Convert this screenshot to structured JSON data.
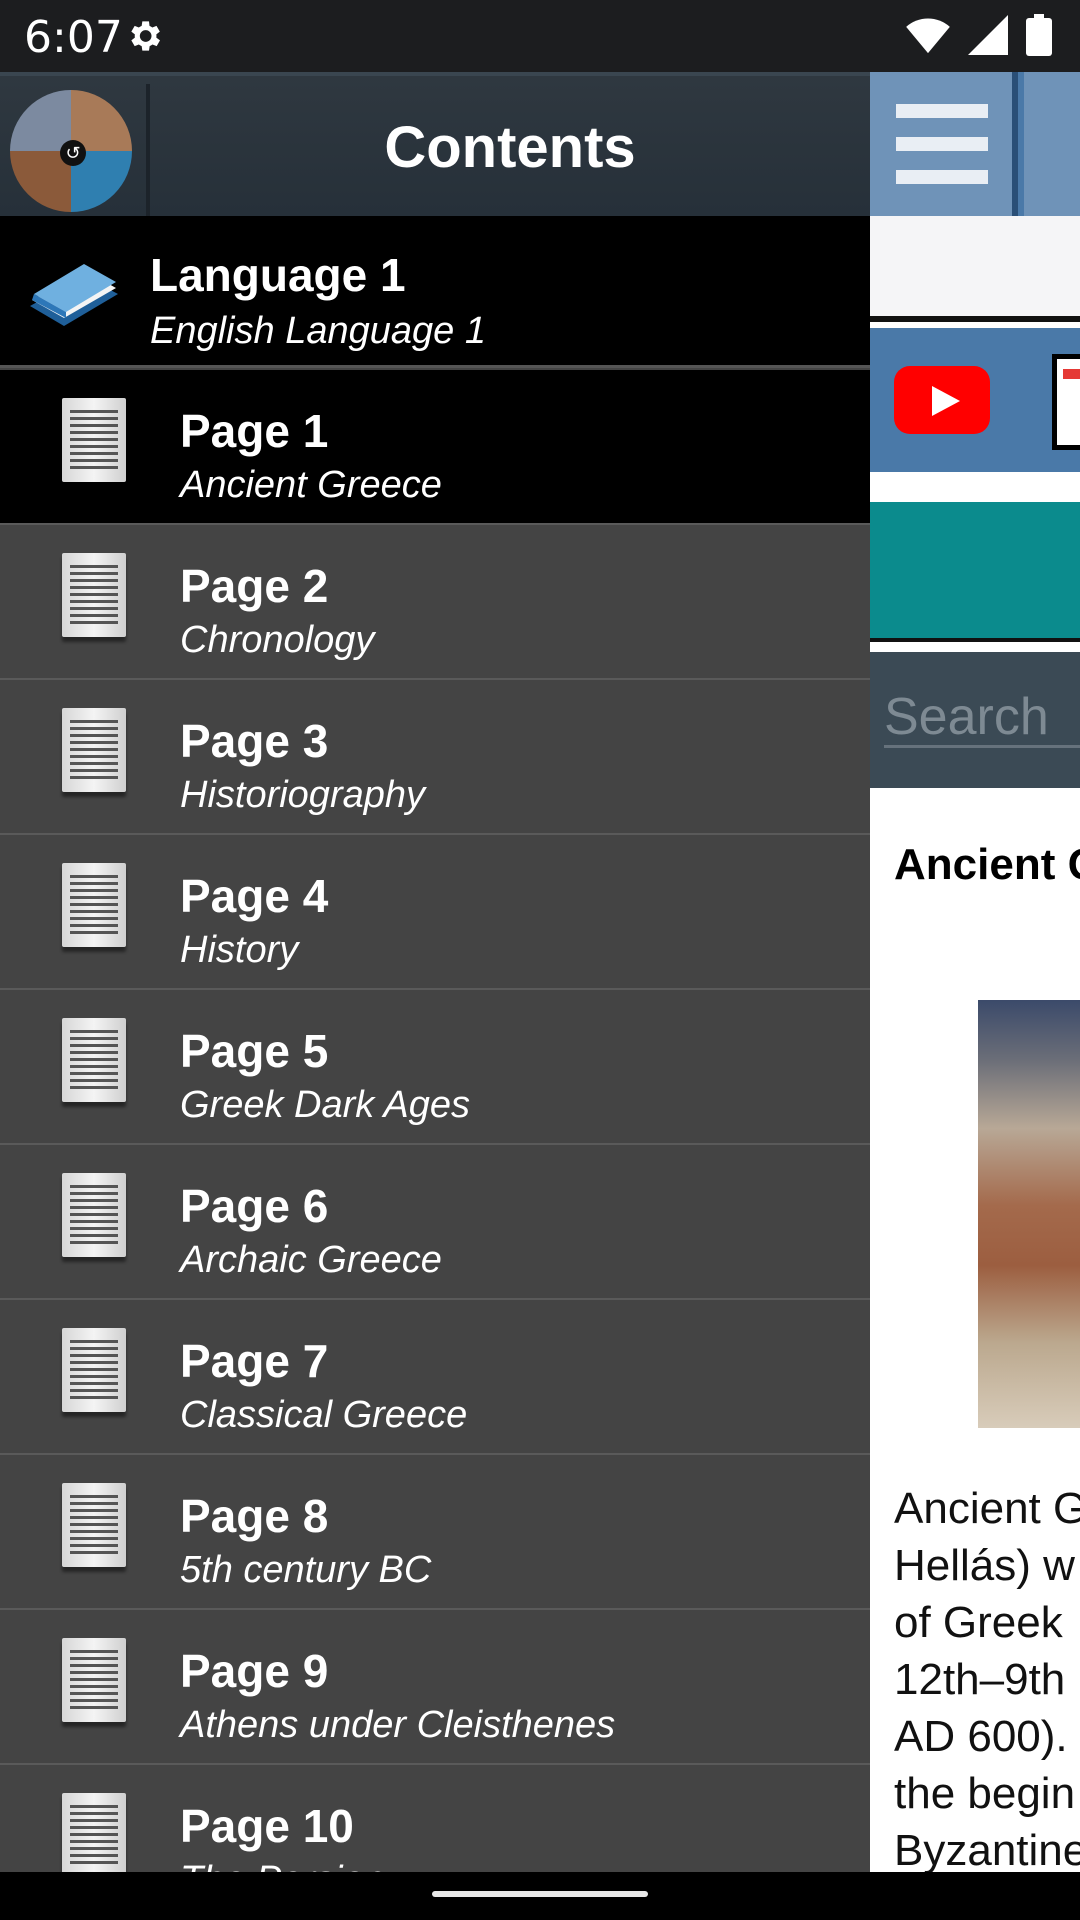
{
  "status_bar": {
    "time": "6:07",
    "icons": [
      "gear-icon",
      "wifi-icon",
      "signal-icon",
      "battery-icon"
    ]
  },
  "drawer": {
    "title": "Contents",
    "language": {
      "title": "Language 1",
      "subtitle": "English Language 1"
    },
    "pages": [
      {
        "title": "Page 1",
        "subtitle": "Ancient Greece",
        "active": true
      },
      {
        "title": "Page 2",
        "subtitle": "Chronology",
        "active": false
      },
      {
        "title": "Page 3",
        "subtitle": "Historiography",
        "active": false
      },
      {
        "title": "Page 4",
        "subtitle": "History",
        "active": false
      },
      {
        "title": "Page 5",
        "subtitle": "Greek Dark Ages",
        "active": false
      },
      {
        "title": "Page 6",
        "subtitle": "Archaic Greece",
        "active": false
      },
      {
        "title": "Page 7",
        "subtitle": "Classical Greece",
        "active": false
      },
      {
        "title": "Page 8",
        "subtitle": "5th century BC",
        "active": false
      },
      {
        "title": "Page 9",
        "subtitle": "Athens under Cleisthenes",
        "active": false
      },
      {
        "title": "Page 10",
        "subtitle": "The Persian",
        "active": false
      }
    ]
  },
  "main": {
    "search_placeholder": "Search",
    "article_title": "Ancient G",
    "article_lines": [
      "Ancient G",
      "Hellás) w",
      "of Greek",
      "12th–9th",
      "AD 600).",
      "the begin",
      "Byzantine"
    ]
  },
  "colors": {
    "drawer_bg": "#444444",
    "active_item_bg": "#000000",
    "toolbar_blue": "#4a79a8",
    "teal": "#0b8b8d",
    "youtube_red": "#ff0000"
  }
}
